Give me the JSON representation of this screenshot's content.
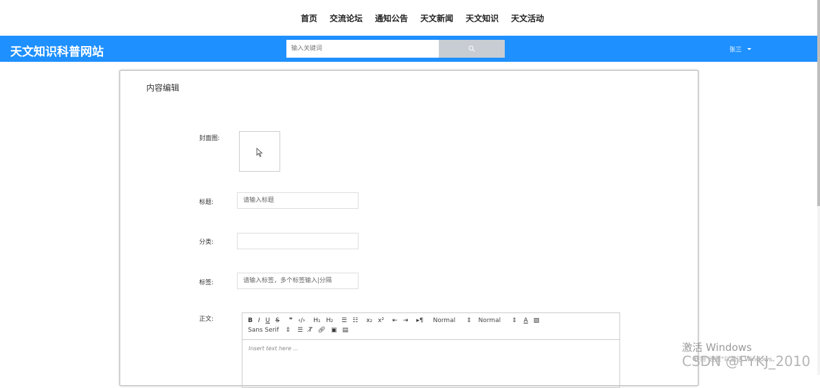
{
  "nav": {
    "links": [
      "首页",
      "交流论坛",
      "通知公告",
      "天文新闻",
      "天文知识",
      "天文活动"
    ]
  },
  "header": {
    "logo": "天文知识科普网站",
    "search_placeholder": "输入关键词",
    "search_icon": "search-icon",
    "user_name": "张三",
    "bar_color": "#1e90ff"
  },
  "panel": {
    "title": "内容编辑",
    "labels": {
      "cover": "封面图:",
      "title": "标题:",
      "category": "分类:",
      "tags": "标签:",
      "body": "正文:"
    },
    "placeholders": {
      "title": "请输入标题",
      "category": "",
      "tags": "请输入标签，多个标签输入|分隔"
    }
  },
  "editor": {
    "toolbar_row1": [
      "B",
      "I",
      "U",
      "S",
      "❞",
      "‹/›",
      "H₁",
      "H₂",
      "☰",
      "☷",
      "x₂",
      "x²",
      "⇤",
      "⇥",
      "▸¶"
    ],
    "header_select": "Normal",
    "size_select": "Normal",
    "font_select": "Sans Serif",
    "placeholder": "Insert text here ..."
  },
  "watermark": {
    "activate_title": "激活 Windows",
    "activate_sub": "转到\"设置\"以激活 Windows。",
    "csdn": "CSDN @FYKJ_2010"
  }
}
